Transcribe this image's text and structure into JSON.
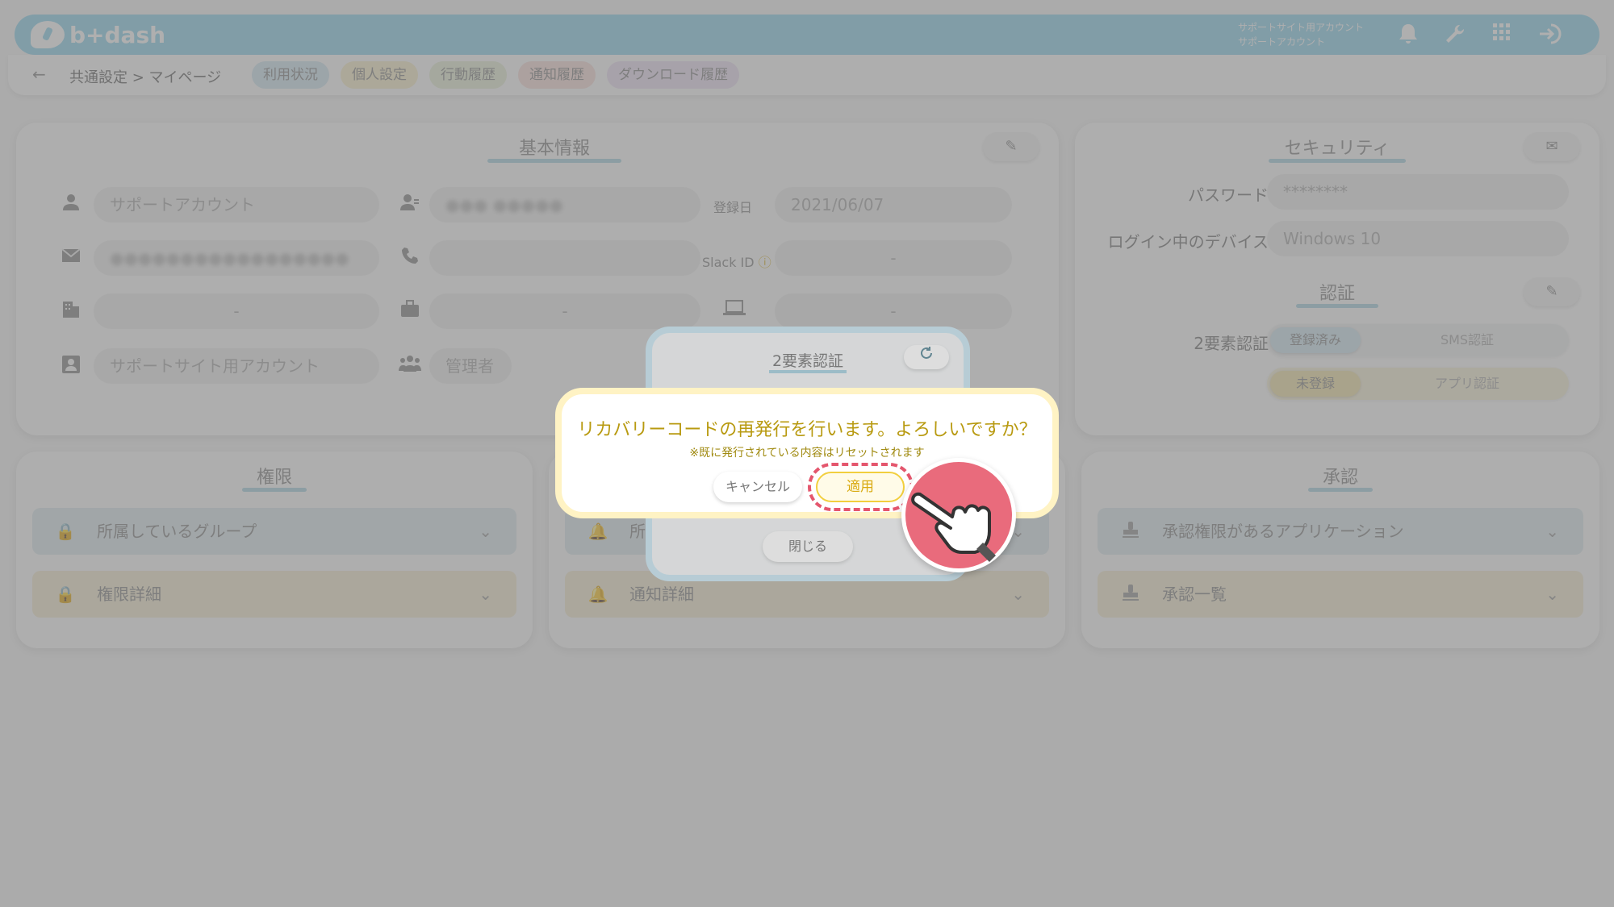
{
  "header": {
    "logo_text": "b+dash",
    "account_line1": "サポートサイト用アカウント",
    "account_line2": "サポートアカウント"
  },
  "subnav": {
    "breadcrumb": "共通設定 > マイページ",
    "tabs": [
      {
        "label": "利用状況"
      },
      {
        "label": "個人設定"
      },
      {
        "label": "行動履歴"
      },
      {
        "label": "通知履歴"
      },
      {
        "label": "ダウンロード履歴"
      }
    ]
  },
  "basic_info": {
    "title": "基本情報",
    "name": "サポートアカウント",
    "registered_label": "登録日",
    "registered_date": "2021/06/07",
    "slack_label": "Slack ID",
    "slack_value": "-",
    "company_value": "-",
    "department_value": "-",
    "device_value": "-",
    "role_value": "サポートサイト用アカウント",
    "permission_value": "管理者"
  },
  "security": {
    "title": "セキュリティ",
    "password_label": "パスワード",
    "password_value": "********",
    "device_label": "ログイン中のデバイス",
    "device_value": "Windows 10",
    "auth_title": "認証",
    "twofa_label": "2要素認証",
    "sms_on": "登録済み",
    "sms_off": "SMS認証",
    "app_on": "未登録",
    "app_off": "アプリ認証"
  },
  "permissions": {
    "title": "権限",
    "items": [
      "所属しているグループ",
      "権限詳細"
    ]
  },
  "notifications": {
    "items": [
      "所",
      "通知詳細"
    ]
  },
  "approval": {
    "title": "承認",
    "items": [
      "承認権限があるアプリケーション",
      "承認一覧"
    ]
  },
  "twofa_modal": {
    "title": "2要素認証",
    "close_label": "閉じる"
  },
  "confirm_dialog": {
    "message": "リカバリーコードの再発行を行います。よろしいですか？",
    "note": "※既に発行されている内容はリセットされます",
    "cancel_label": "キャンセル",
    "apply_label": "適用"
  },
  "colors": {
    "header_bg": "#8fd3ec",
    "confirm_text": "#b89a10",
    "apply_border": "#f2cf3e",
    "highlight": "#e4566d",
    "pointer_bg": "#e96b7c"
  }
}
